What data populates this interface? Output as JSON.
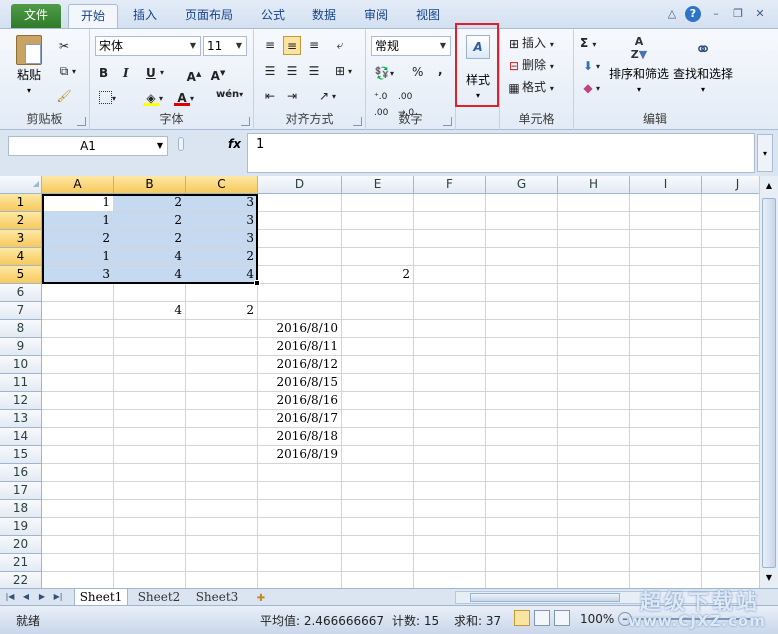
{
  "tabs": [
    "文件",
    "开始",
    "插入",
    "页面布局",
    "公式",
    "数据",
    "审阅",
    "视图"
  ],
  "ribbon": {
    "clipboard": {
      "paste": "粘贴",
      "label": "剪贴板"
    },
    "font": {
      "name": "宋体",
      "size": "11",
      "label": "字体",
      "bold": "B",
      "italic": "I",
      "underline": "U"
    },
    "alignment": {
      "label": "对齐方式"
    },
    "number": {
      "format": "常规",
      "label": "数字",
      "percent": "%",
      "comma": ","
    },
    "styles": {
      "label": "样式"
    },
    "cells": {
      "insert": "插入",
      "delete": "删除",
      "format": "格式",
      "label": "单元格"
    },
    "editing": {
      "sort": "排序和筛选",
      "find": "查找和选择",
      "label": "编辑",
      "sum": "Σ"
    }
  },
  "formula_bar": {
    "name_box": "A1",
    "fx": "fx",
    "value": "1"
  },
  "columns": [
    "A",
    "B",
    "C",
    "D",
    "E",
    "F",
    "G",
    "H",
    "I",
    "J"
  ],
  "rows": [
    "1",
    "2",
    "3",
    "4",
    "5",
    "6",
    "7",
    "8",
    "9",
    "10",
    "11",
    "12",
    "13",
    "14",
    "15",
    "16",
    "17",
    "18",
    "19",
    "20",
    "21",
    "22"
  ],
  "cells": {
    "A1": "1",
    "B1": "2",
    "C1": "3",
    "A2": "1",
    "B2": "2",
    "C2": "3",
    "A3": "2",
    "B3": "2",
    "C3": "3",
    "A4": "1",
    "B4": "4",
    "C4": "2",
    "A5": "3",
    "B5": "4",
    "C5": "4",
    "E5": "2",
    "B7": "4",
    "C7": "2",
    "D8": "2016/8/10",
    "D9": "2016/8/11",
    "D10": "2016/8/12",
    "D11": "2016/8/15",
    "D12": "2016/8/16",
    "D13": "2016/8/17",
    "D14": "2016/8/18",
    "D15": "2016/8/19"
  },
  "sheets": [
    "Sheet1",
    "Sheet2",
    "Sheet3"
  ],
  "status": {
    "ready": "就绪",
    "average": "平均值: 2.466666667",
    "count": "计数: 15",
    "sum": "求和: 37",
    "zoom": "100%"
  },
  "watermark": {
    "line1": "超级下载站",
    "line2": "www.CJXZ.com"
  }
}
